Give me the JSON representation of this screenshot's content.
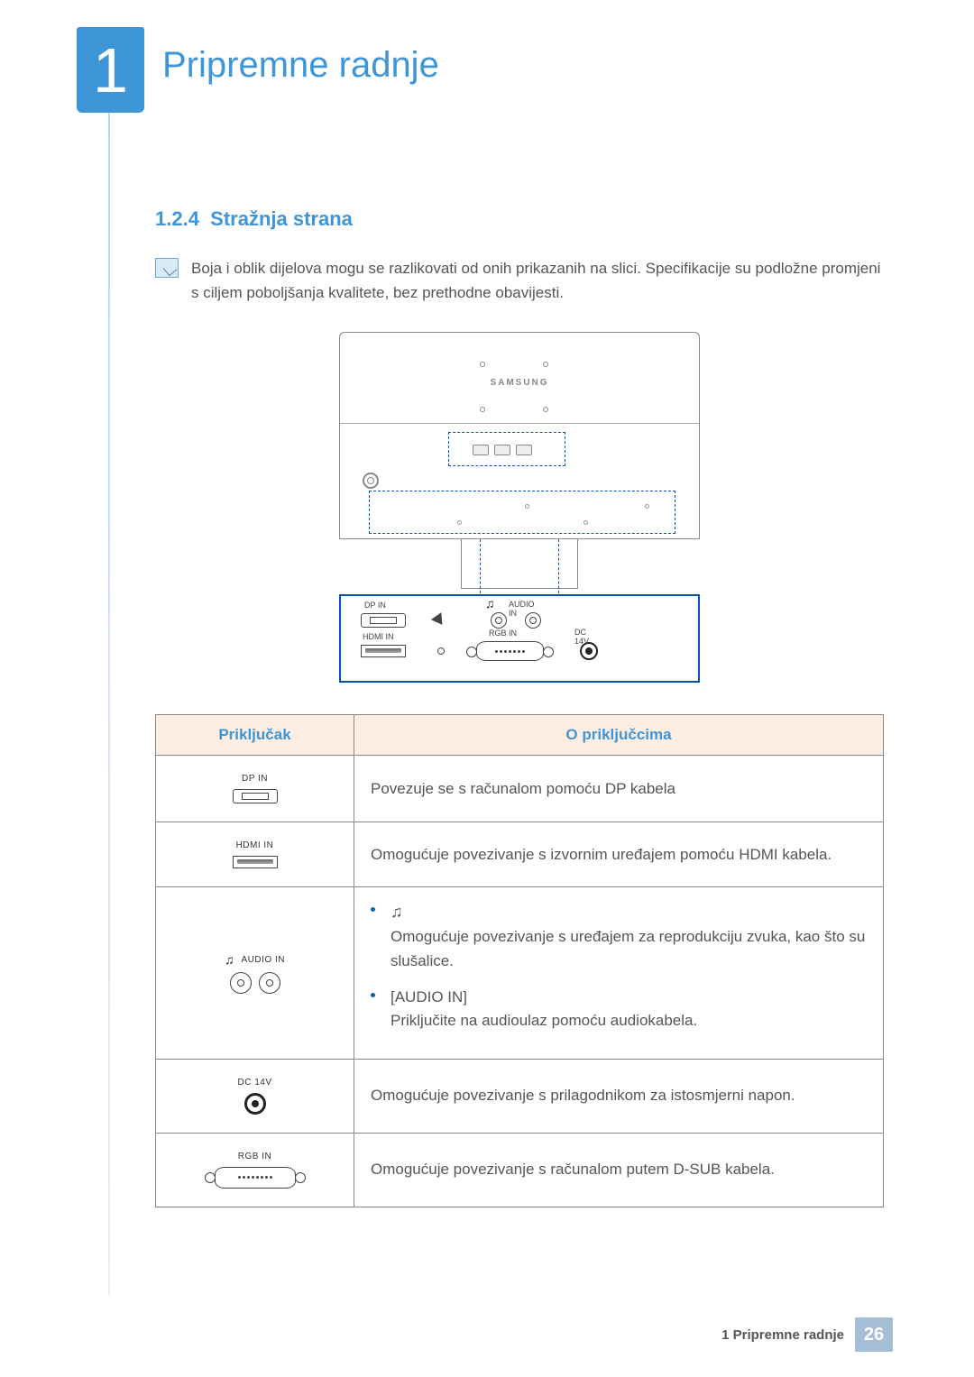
{
  "chapter": {
    "number": "1",
    "title": "Pripremne radnje"
  },
  "section": {
    "number": "1.2.4",
    "title": "Stražnja strana"
  },
  "note": "Boja i oblik dijelova mogu se razlikovati od onih prikazanih na slici. Specifikacije su podložne promjeni s ciljem poboljšanja kvalitete, bez prethodne obavijesti.",
  "diagram": {
    "brand": "SAMSUNG",
    "port_labels": {
      "dp": "DP IN",
      "hdmi": "HDMI IN",
      "audio": "AUDIO IN",
      "rgb": "RGB IN",
      "dc": "DC 14V"
    }
  },
  "table": {
    "headers": {
      "port": "Priključak",
      "desc": "O priključcima"
    },
    "rows": [
      {
        "label": "DP IN",
        "type": "dp",
        "desc": "Povezuje se s računalom pomoću DP kabela"
      },
      {
        "label": "HDMI IN",
        "type": "hdmi",
        "desc": "Omogućuje povezivanje s izvornim uređajem pomoću HDMI kabela."
      },
      {
        "label": "AUDIO IN",
        "type": "audio",
        "bullets": [
          {
            "icon": "headphones",
            "text": "Omogućuje povezivanje s uređajem za reprodukciju zvuka, kao što su slušalice."
          },
          {
            "label": "[AUDIO IN]",
            "text": "Priključite na audioulaz pomoću audiokabela."
          }
        ]
      },
      {
        "label": "DC 14V",
        "type": "dc",
        "desc": "Omogućuje povezivanje s prilagodnikom za istosmjerni napon."
      },
      {
        "label": "RGB IN",
        "type": "rgb",
        "desc": "Omogućuje povezivanje s računalom putem D-SUB kabela."
      }
    ]
  },
  "footer": {
    "title": "1 Pripremne radnje",
    "page": "26"
  }
}
